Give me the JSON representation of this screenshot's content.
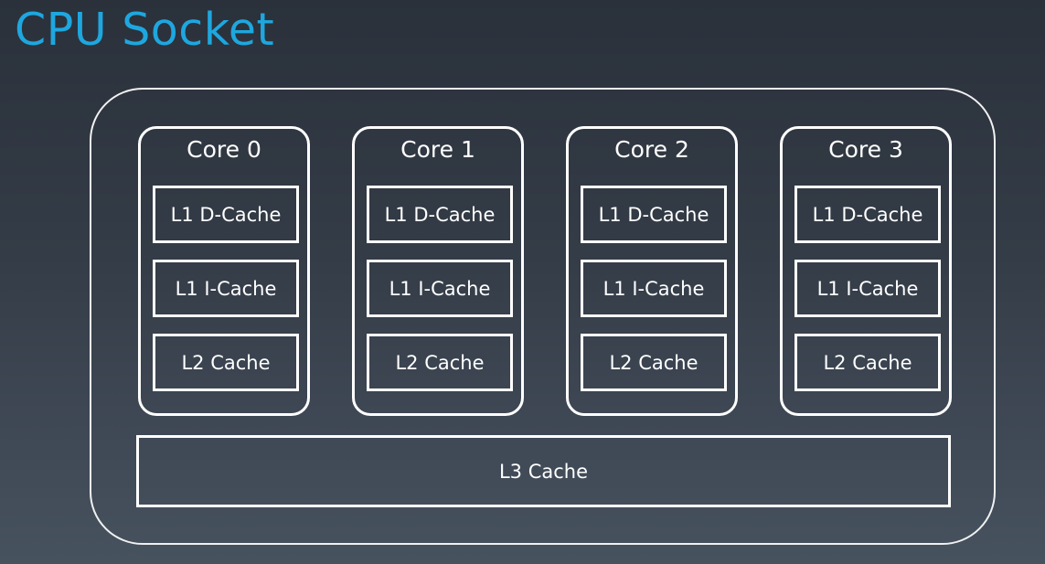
{
  "title": "CPU Socket",
  "cores": [
    {
      "label": "Core 0",
      "caches": [
        "L1 D-Cache",
        "L1 I-Cache",
        "L2 Cache"
      ]
    },
    {
      "label": "Core 1",
      "caches": [
        "L1 D-Cache",
        "L1 I-Cache",
        "L2 Cache"
      ]
    },
    {
      "label": "Core 2",
      "caches": [
        "L1 D-Cache",
        "L1 I-Cache",
        "L2 Cache"
      ]
    },
    {
      "label": "Core 3",
      "caches": [
        "L1 D-Cache",
        "L1 I-Cache",
        "L2 Cache"
      ]
    }
  ],
  "shared_cache": {
    "label": "L3 Cache"
  },
  "colors": {
    "title": "#1ea7df",
    "outline": "#ffffff",
    "background_top": "#2a313b",
    "background_bottom": "#47525f"
  }
}
